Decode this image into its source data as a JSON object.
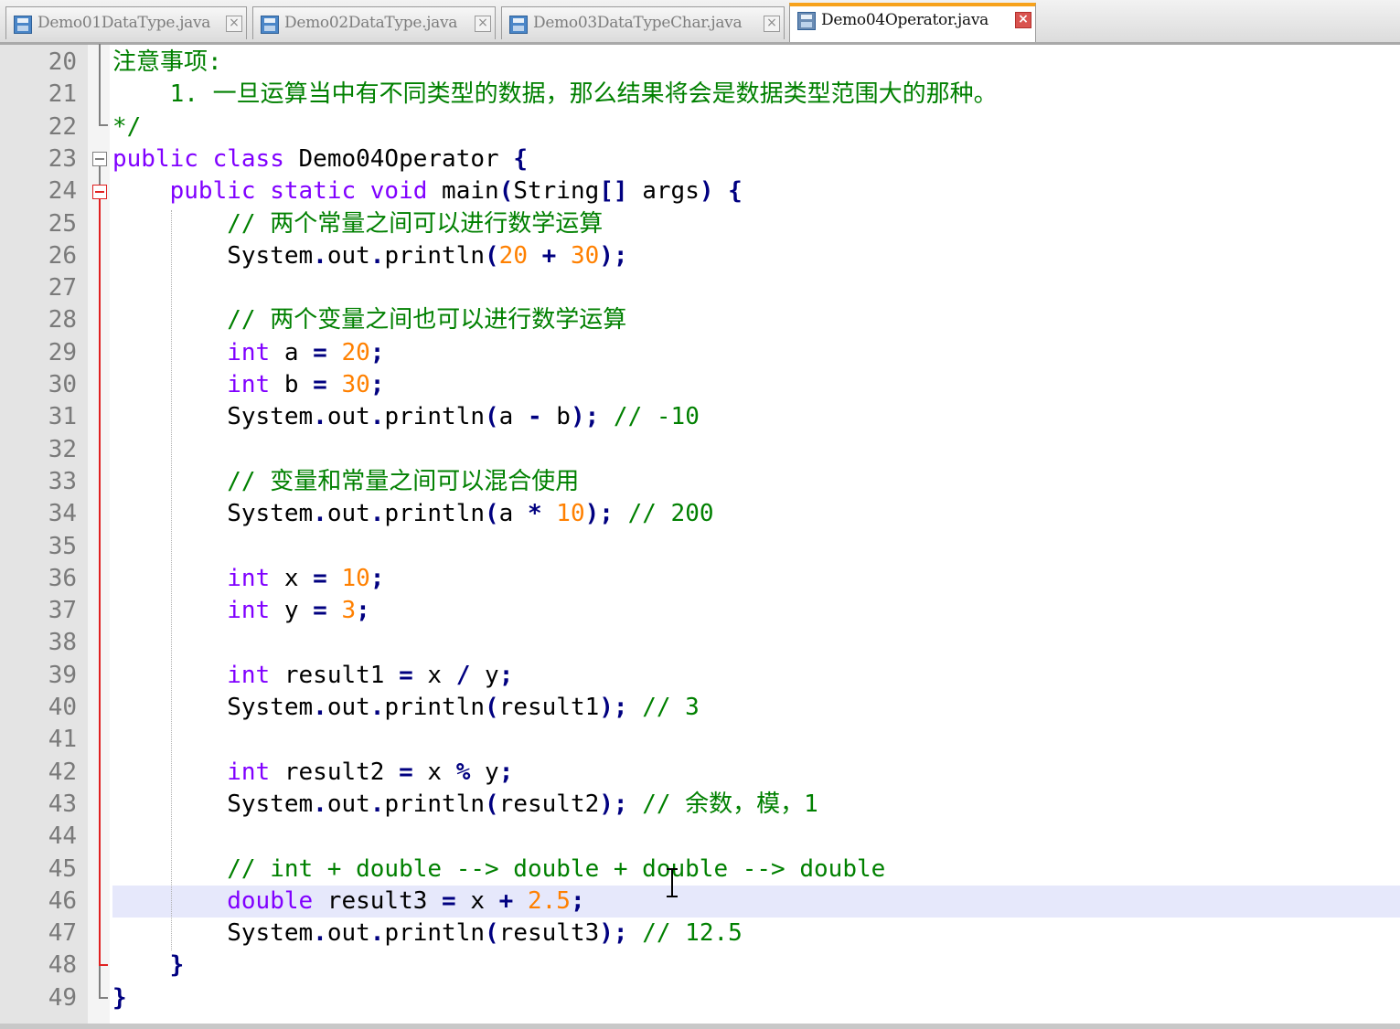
{
  "tabs": [
    {
      "label": "Demo01DataType.java",
      "active": false,
      "close": "×"
    },
    {
      "label": "Demo02DataType.java",
      "active": false,
      "close": "×"
    },
    {
      "label": "Demo03DataTypeChar.java",
      "active": false,
      "close": "×"
    },
    {
      "label": "Demo04Operator.java",
      "active": true,
      "close": "×"
    }
  ],
  "editor": {
    "current_line": 46,
    "colors": {
      "comment": "#008000",
      "keyword": "#8000ff",
      "number": "#ff8000",
      "operator": "#000080",
      "active_tab_accent": "#f7a21b",
      "current_line_bg": "#e6e8fb",
      "fold_marker": "#e02020"
    },
    "lines": [
      {
        "n": "20",
        "tokens": [
          [
            "cm",
            "注意事项:"
          ]
        ]
      },
      {
        "n": "21",
        "tokens": [
          [
            "cm",
            "    1. 一旦运算当中有不同类型的数据，那么结果将会是数据类型范围大的那种。"
          ]
        ]
      },
      {
        "n": "22",
        "tokens": [
          [
            "cm",
            "*/"
          ]
        ]
      },
      {
        "n": "23",
        "tokens": [
          [
            "kw",
            "public"
          ],
          [
            "idn",
            " "
          ],
          [
            "kw",
            "class"
          ],
          [
            "idn",
            " Demo04Operator "
          ],
          [
            "op",
            "{"
          ]
        ]
      },
      {
        "n": "24",
        "tokens": [
          [
            "idn",
            "    "
          ],
          [
            "kw",
            "public"
          ],
          [
            "idn",
            " "
          ],
          [
            "kw",
            "static"
          ],
          [
            "idn",
            " "
          ],
          [
            "kw",
            "void"
          ],
          [
            "idn",
            " main"
          ],
          [
            "op",
            "("
          ],
          [
            "idn",
            "String"
          ],
          [
            "op",
            "[]"
          ],
          [
            "idn",
            " args"
          ],
          [
            "op",
            ")"
          ],
          [
            "idn",
            " "
          ],
          [
            "op",
            "{"
          ]
        ]
      },
      {
        "n": "25",
        "tokens": [
          [
            "idn",
            "        "
          ],
          [
            "cm",
            "// 两个常量之间可以进行数学运算"
          ]
        ]
      },
      {
        "n": "26",
        "tokens": [
          [
            "idn",
            "        System"
          ],
          [
            "op",
            "."
          ],
          [
            "idn",
            "out"
          ],
          [
            "op",
            "."
          ],
          [
            "idn",
            "println"
          ],
          [
            "op",
            "("
          ],
          [
            "num",
            "20"
          ],
          [
            "idn",
            " "
          ],
          [
            "op",
            "+"
          ],
          [
            "idn",
            " "
          ],
          [
            "num",
            "30"
          ],
          [
            "op",
            ");"
          ]
        ]
      },
      {
        "n": "27",
        "tokens": []
      },
      {
        "n": "28",
        "tokens": [
          [
            "idn",
            "        "
          ],
          [
            "cm",
            "// 两个变量之间也可以进行数学运算"
          ]
        ]
      },
      {
        "n": "29",
        "tokens": [
          [
            "idn",
            "        "
          ],
          [
            "kw",
            "int"
          ],
          [
            "idn",
            " a "
          ],
          [
            "op",
            "="
          ],
          [
            "idn",
            " "
          ],
          [
            "num",
            "20"
          ],
          [
            "op",
            ";"
          ]
        ]
      },
      {
        "n": "30",
        "tokens": [
          [
            "idn",
            "        "
          ],
          [
            "kw",
            "int"
          ],
          [
            "idn",
            " b "
          ],
          [
            "op",
            "="
          ],
          [
            "idn",
            " "
          ],
          [
            "num",
            "30"
          ],
          [
            "op",
            ";"
          ]
        ]
      },
      {
        "n": "31",
        "tokens": [
          [
            "idn",
            "        System"
          ],
          [
            "op",
            "."
          ],
          [
            "idn",
            "out"
          ],
          [
            "op",
            "."
          ],
          [
            "idn",
            "println"
          ],
          [
            "op",
            "("
          ],
          [
            "idn",
            "a "
          ],
          [
            "op",
            "-"
          ],
          [
            "idn",
            " b"
          ],
          [
            "op",
            ");"
          ],
          [
            "idn",
            " "
          ],
          [
            "cm",
            "// -10"
          ]
        ]
      },
      {
        "n": "32",
        "tokens": []
      },
      {
        "n": "33",
        "tokens": [
          [
            "idn",
            "        "
          ],
          [
            "cm",
            "// 变量和常量之间可以混合使用"
          ]
        ]
      },
      {
        "n": "34",
        "tokens": [
          [
            "idn",
            "        System"
          ],
          [
            "op",
            "."
          ],
          [
            "idn",
            "out"
          ],
          [
            "op",
            "."
          ],
          [
            "idn",
            "println"
          ],
          [
            "op",
            "("
          ],
          [
            "idn",
            "a "
          ],
          [
            "op",
            "*"
          ],
          [
            "idn",
            " "
          ],
          [
            "num",
            "10"
          ],
          [
            "op",
            ");"
          ],
          [
            "idn",
            " "
          ],
          [
            "cm",
            "// 200"
          ]
        ]
      },
      {
        "n": "35",
        "tokens": []
      },
      {
        "n": "36",
        "tokens": [
          [
            "idn",
            "        "
          ],
          [
            "kw",
            "int"
          ],
          [
            "idn",
            " x "
          ],
          [
            "op",
            "="
          ],
          [
            "idn",
            " "
          ],
          [
            "num",
            "10"
          ],
          [
            "op",
            ";"
          ]
        ]
      },
      {
        "n": "37",
        "tokens": [
          [
            "idn",
            "        "
          ],
          [
            "kw",
            "int"
          ],
          [
            "idn",
            " y "
          ],
          [
            "op",
            "="
          ],
          [
            "idn",
            " "
          ],
          [
            "num",
            "3"
          ],
          [
            "op",
            ";"
          ]
        ]
      },
      {
        "n": "38",
        "tokens": []
      },
      {
        "n": "39",
        "tokens": [
          [
            "idn",
            "        "
          ],
          [
            "kw",
            "int"
          ],
          [
            "idn",
            " result1 "
          ],
          [
            "op",
            "="
          ],
          [
            "idn",
            " x "
          ],
          [
            "op",
            "/"
          ],
          [
            "idn",
            " y"
          ],
          [
            "op",
            ";"
          ]
        ]
      },
      {
        "n": "40",
        "tokens": [
          [
            "idn",
            "        System"
          ],
          [
            "op",
            "."
          ],
          [
            "idn",
            "out"
          ],
          [
            "op",
            "."
          ],
          [
            "idn",
            "println"
          ],
          [
            "op",
            "("
          ],
          [
            "idn",
            "result1"
          ],
          [
            "op",
            ");"
          ],
          [
            "idn",
            " "
          ],
          [
            "cm",
            "// 3"
          ]
        ]
      },
      {
        "n": "41",
        "tokens": []
      },
      {
        "n": "42",
        "tokens": [
          [
            "idn",
            "        "
          ],
          [
            "kw",
            "int"
          ],
          [
            "idn",
            " result2 "
          ],
          [
            "op",
            "="
          ],
          [
            "idn",
            " x "
          ],
          [
            "op",
            "%"
          ],
          [
            "idn",
            " y"
          ],
          [
            "op",
            ";"
          ]
        ]
      },
      {
        "n": "43",
        "tokens": [
          [
            "idn",
            "        System"
          ],
          [
            "op",
            "."
          ],
          [
            "idn",
            "out"
          ],
          [
            "op",
            "."
          ],
          [
            "idn",
            "println"
          ],
          [
            "op",
            "("
          ],
          [
            "idn",
            "result2"
          ],
          [
            "op",
            ");"
          ],
          [
            "idn",
            " "
          ],
          [
            "cm",
            "// 余数，模，1"
          ]
        ]
      },
      {
        "n": "44",
        "tokens": []
      },
      {
        "n": "45",
        "tokens": [
          [
            "idn",
            "        "
          ],
          [
            "cm",
            "// int + double --> double + double --> double"
          ]
        ]
      },
      {
        "n": "46",
        "tokens": [
          [
            "idn",
            "        "
          ],
          [
            "kw",
            "double"
          ],
          [
            "idn",
            " result3 "
          ],
          [
            "op",
            "="
          ],
          [
            "idn",
            " x "
          ],
          [
            "op",
            "+"
          ],
          [
            "idn",
            " "
          ],
          [
            "num",
            "2.5"
          ],
          [
            "op",
            ";"
          ]
        ]
      },
      {
        "n": "47",
        "tokens": [
          [
            "idn",
            "        System"
          ],
          [
            "op",
            "."
          ],
          [
            "idn",
            "out"
          ],
          [
            "op",
            "."
          ],
          [
            "idn",
            "println"
          ],
          [
            "op",
            "("
          ],
          [
            "idn",
            "result3"
          ],
          [
            "op",
            ");"
          ],
          [
            "idn",
            " "
          ],
          [
            "cm",
            "// 12.5"
          ]
        ]
      },
      {
        "n": "48",
        "tokens": [
          [
            "idn",
            "    "
          ],
          [
            "op",
            "}"
          ]
        ]
      },
      {
        "n": "49",
        "tokens": [
          [
            "op",
            "}"
          ]
        ]
      }
    ]
  }
}
